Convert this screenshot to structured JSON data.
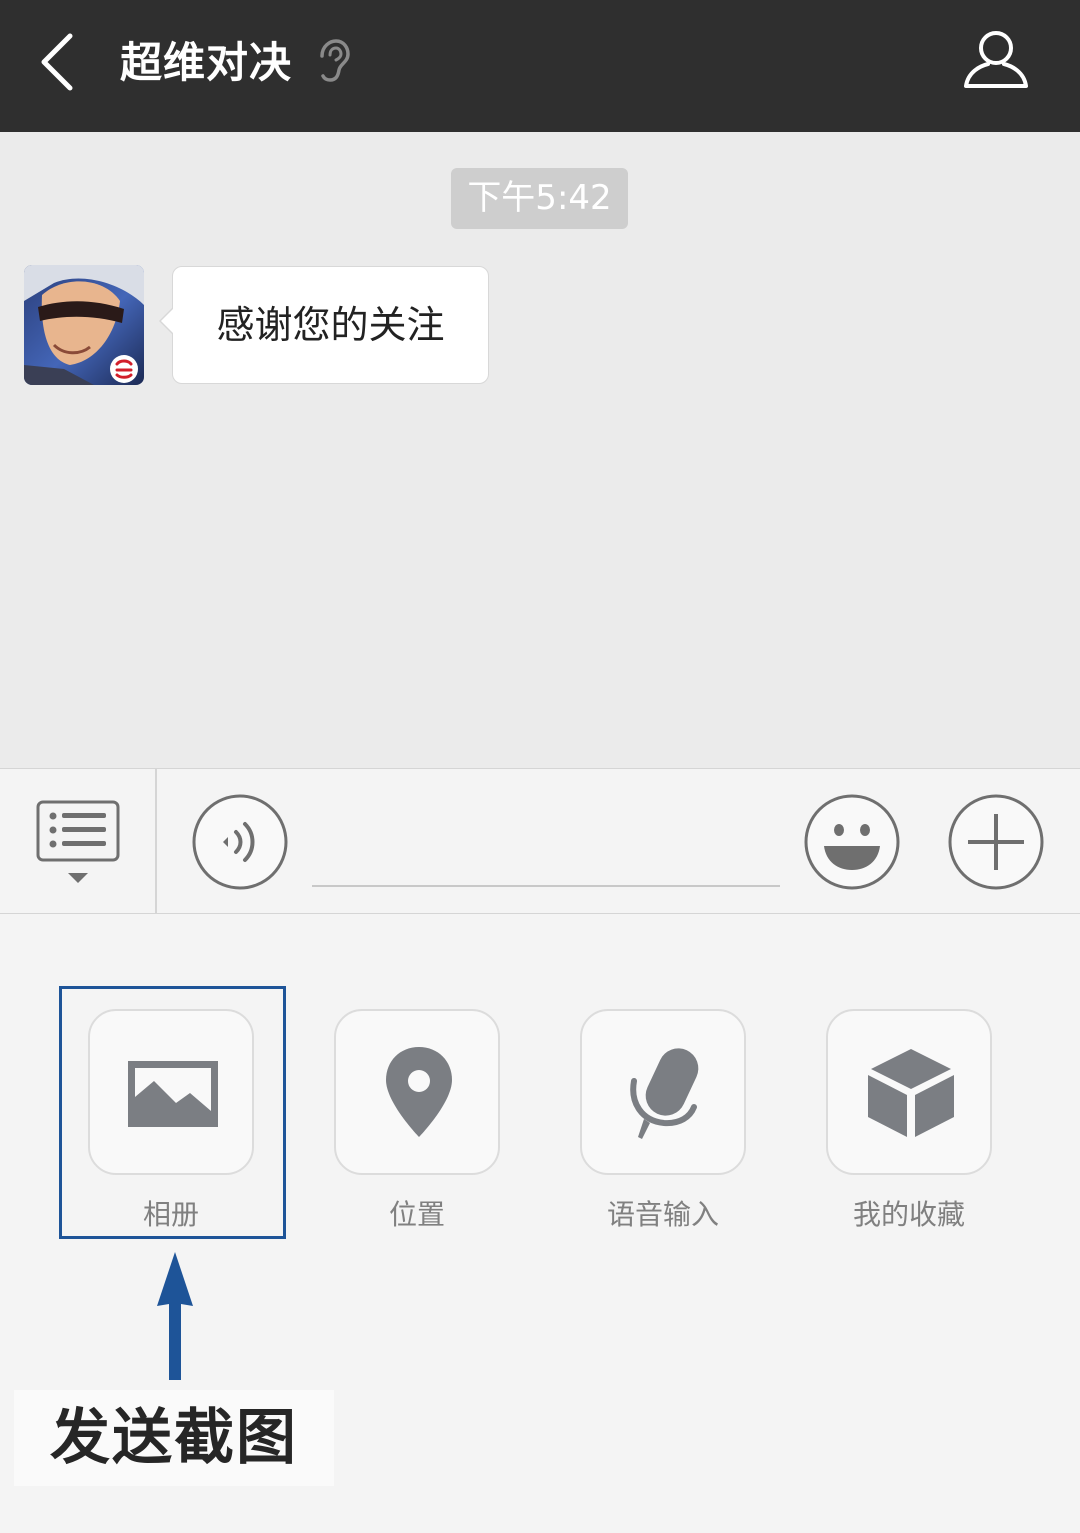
{
  "header": {
    "title": "超维对决"
  },
  "chat": {
    "timestamp": "下午5:42",
    "messages": [
      {
        "text": "感谢您的关注"
      }
    ]
  },
  "input": {
    "value": "",
    "placeholder": ""
  },
  "tools": [
    {
      "label": "相册",
      "icon": "image-icon"
    },
    {
      "label": "位置",
      "icon": "location-pin-icon"
    },
    {
      "label": "语音输入",
      "icon": "microphone-icon"
    },
    {
      "label": "我的收藏",
      "icon": "cube-icon"
    }
  ],
  "annotation": {
    "caption": "发送截图",
    "color": "#1e5498"
  },
  "colors": {
    "topbar": "#2f2f2f",
    "chat_background": "#ebebeb",
    "panel_background": "#f4f4f4",
    "icon_gray": "#7b7e83"
  }
}
